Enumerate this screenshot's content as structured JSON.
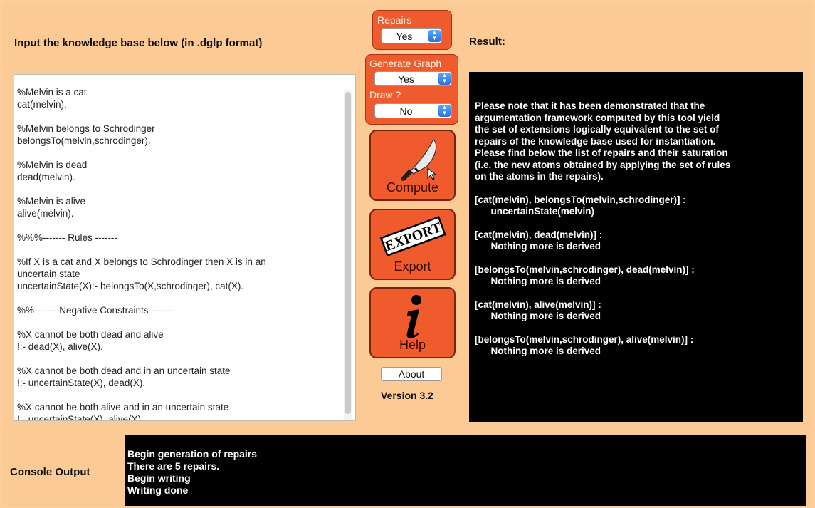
{
  "headings": {
    "kb": "Input the knowledge base below (in .dglp format)",
    "result": "Result:",
    "console": "Console Output"
  },
  "controls": {
    "repairs": {
      "label": "Repairs",
      "value": "Yes"
    },
    "generate_graph": {
      "label": "Generate Graph",
      "value": "Yes"
    },
    "draw": {
      "label": "Draw ?",
      "value": "No"
    },
    "compute_label": "Compute",
    "export_label": "Export",
    "export_stamp": "EXPORT",
    "help_label": "Help",
    "about_label": "About",
    "version": "Version 3.2"
  },
  "knowledge_base": [
    "%Melvin is a cat",
    "cat(melvin).",
    "",
    "%Melvin belongs to Schrodinger",
    "belongsTo(melvin,schrodinger).",
    "",
    "%Melvin is dead",
    "dead(melvin).",
    "",
    "%Melvin is alive",
    "alive(melvin).",
    "",
    "%%%------- Rules -------",
    "",
    "%If X is a cat and X belongs to Schrodinger then X is in an",
    "uncertain state",
    "uncertainState(X):- belongsTo(X,schrodinger), cat(X).",
    "",
    "%%------- Negative Constraints -------",
    "",
    "%X cannot be both dead and alive",
    "!:- dead(X), alive(X).",
    "",
    "%X cannot be both dead and in an uncertain state",
    "!:- uncertainState(X), dead(X).",
    "",
    "%X cannot be both alive and in an uncertain state",
    "!:- uncertainState(X), alive(X)."
  ],
  "result": {
    "intro": "Please note that it has been demonstrated that the\nargumentation framework computed by this tool yield\nthe set of extensions logically equivalent to the set of\nrepairs of the knowledge base used for instantiation.\nPlease find below the list of repairs and their saturation\n(i.e. the new atoms obtained by applying the set of rules\non the atoms in the repairs).",
    "repairs": [
      {
        "set": "[cat(melvin), belongsTo(melvin,schrodinger)] :",
        "derived": "      uncertainState(melvin)"
      },
      {
        "set": "[cat(melvin), dead(melvin)] :",
        "derived": "      Nothing more is derived"
      },
      {
        "set": "[belongsTo(melvin,schrodinger), dead(melvin)] :",
        "derived": "      Nothing more is derived"
      },
      {
        "set": "[cat(melvin), alive(melvin)] :",
        "derived": "      Nothing more is derived"
      },
      {
        "set": "[belongsTo(melvin,schrodinger), alive(melvin)] :",
        "derived": "      Nothing more is derived"
      }
    ]
  },
  "console": {
    "lines": [
      "Begin generation of repairs",
      "There are 5 repairs.",
      "Begin writing",
      "Writing done"
    ]
  }
}
